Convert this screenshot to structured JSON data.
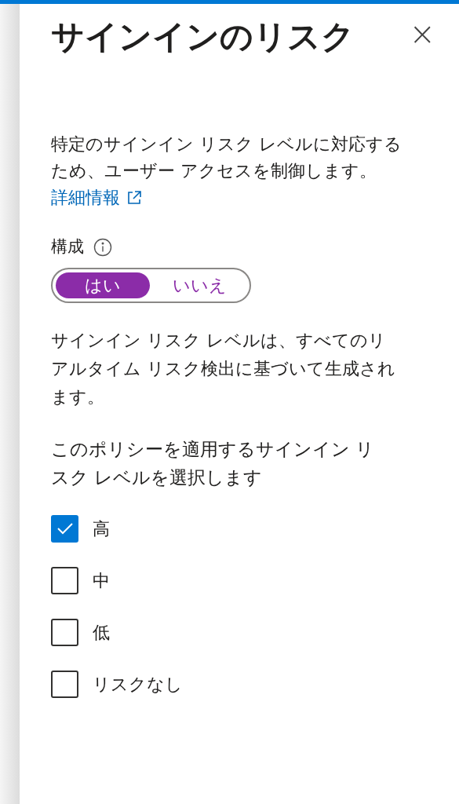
{
  "panel": {
    "title": "サインインのリスク",
    "close": "×"
  },
  "description": "特定のサインイン リスク レベルに対応するため、ユーザー アクセスを制御します。",
  "learn_more": "詳細情報",
  "configure": {
    "label": "構成",
    "options": [
      {
        "label": "はい",
        "selected": true
      },
      {
        "label": "いいえ",
        "selected": false
      }
    ]
  },
  "info_text": "サインイン リスク レベルは、すべてのリアルタイム リスク検出に基づいて生成されます。",
  "levels_heading": "このポリシーを適用するサインイン リスク レベルを選択します",
  "levels": [
    {
      "label": "高",
      "checked": true
    },
    {
      "label": "中",
      "checked": false
    },
    {
      "label": "低",
      "checked": false
    },
    {
      "label": "リスクなし",
      "checked": false
    }
  ]
}
